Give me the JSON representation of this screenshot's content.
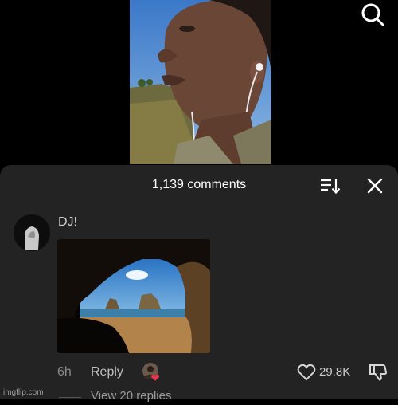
{
  "video": {
    "content": "man wearing white earphones outdoors"
  },
  "header_icons": {
    "search": "search-icon"
  },
  "comments_panel": {
    "count_label": "1,139 comments",
    "sort_icon": "sort-icon",
    "close_icon": "close-icon"
  },
  "comment": {
    "username": "DJ!",
    "image_content": "view from inside a sea cave toward a beach and rock stacks",
    "timestamp": "6h",
    "reply_label": "Reply",
    "likes": "29.8K",
    "view_replies": "View 20 replies"
  },
  "watermark": "imgflip.com",
  "colors": {
    "sheet_bg": "#232323",
    "text": "#ffffff",
    "secondary": "#8a8a8a",
    "heart_badge": "#e8344f"
  }
}
